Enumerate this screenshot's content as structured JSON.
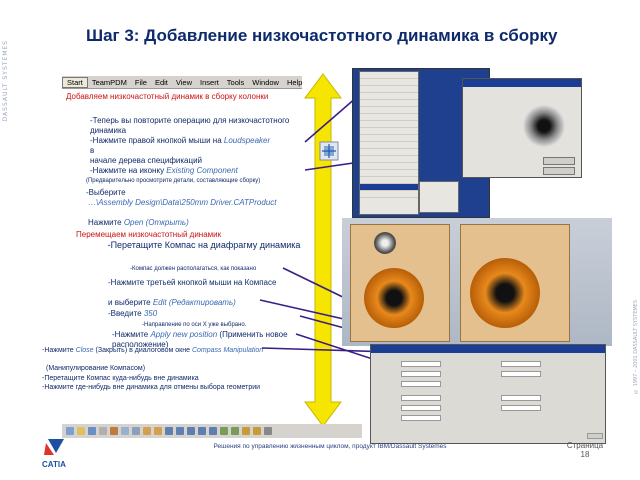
{
  "side_brand": "DASSAULT SYSTEMES",
  "side_copyright": "© 1997 – 2001 DASSAULT SYSTEMES",
  "title": "Шаг 3: Добавление низкочастотного динамика в сборку",
  "menubar": [
    "Start",
    "TeamPDM",
    "File",
    "Edit",
    "View",
    "Insert",
    "Tools",
    "Window",
    "Help"
  ],
  "section1": {
    "heading": "Добавляем низкочастотный динамик в сборку колонки",
    "repeat": "-Теперь вы повторите операцию для низкочастотного динамика",
    "right_click_a": "-Нажмите правой кнопкой мыши на",
    "right_click_target": "Loudspeaker",
    "right_click_b": "в",
    "right_click_c": "начале дерева спецификаций",
    "existing_a": "-Нажмите на иконку",
    "existing_target": "Existing Component",
    "preview_note": "(Предварительно просмотрите детали, составляющие сборку)",
    "select_a": "-Выберите",
    "select_path": "…\\Assembly Design\\Data\\250mm Driver.CATProduct",
    "open_a": "Нажмите",
    "open_target": "Open (Открыть)"
  },
  "section2": {
    "heading": "Перемещаем низкочастотный динамик",
    "drag": "-Перетащите Компас на диафрагму динамика",
    "compass_note": "-Компас должен располагаться, как показано",
    "third_click": "-Нажмите третьей кнопкой мыши на Компасе",
    "choose_a": "и выберите",
    "choose_target": "Edit (Редактировать)",
    "enter_a": "-Введите",
    "enter_value": "350",
    "direction_note": "-Направление по оси X уже выбрано.",
    "apply_a": "-Нажмите",
    "apply_target": "Apply new position",
    "apply_b": "(Применить новое расположение)"
  },
  "section3": {
    "close_a": "-Нажмите",
    "close_target": "Close",
    "close_b": "(Закрыть) в диалоговом окне",
    "close_c": "Compass Manipulation",
    "close_d": "(Манипулирование Компасом)",
    "drag_out": "-Перетащите Компас куда-нибудь вне динамика",
    "deselect": "-Нажмите где-нибудь вне динамика для отмены выбора геометрии"
  },
  "footer": "Решения по управлению жизненным циклом, продукт IBM/Dassault Systemes",
  "page_label": "Страница",
  "page_number": "18",
  "logo_text": "CATIA",
  "colors": {
    "title": "#0d2a6b",
    "heading_red": "#cc1111",
    "body_navy": "#102a6b",
    "highlight_blue": "#3a68b4",
    "arrow_yellow": "#f5e500",
    "pointer_purple": "#3b1e86"
  }
}
